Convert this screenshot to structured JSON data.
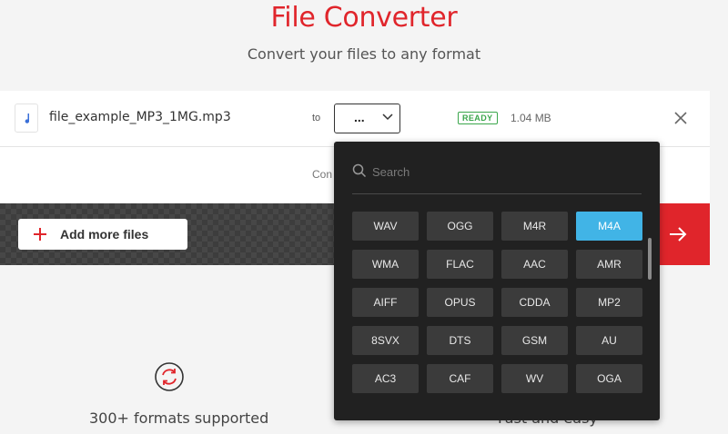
{
  "header": {
    "title": "File Converter",
    "subtitle": "Convert your files to any format"
  },
  "file": {
    "name": "file_example_MP3_1MG.mp3",
    "to_label": "to",
    "selected_format": "...",
    "status": "READY",
    "size": "1.04 MB"
  },
  "convert_hint": "Con",
  "actions": {
    "add_files_label": "Add more files"
  },
  "dropdown": {
    "search_placeholder": "Search",
    "formats": [
      "WAV",
      "OGG",
      "M4R",
      "M4A",
      "WMA",
      "FLAC",
      "AAC",
      "AMR",
      "AIFF",
      "OPUS",
      "CDDA",
      "MP2",
      "8SVX",
      "DTS",
      "GSM",
      "AU",
      "AC3",
      "CAF",
      "WV",
      "OGA"
    ],
    "active_format": "M4A"
  },
  "features": {
    "formats_supported": "300+ formats supported",
    "fast_easy": "Fast and easy"
  },
  "colors": {
    "brand_red": "#e0252b",
    "accent_blue": "#41b4e6",
    "ready_green": "#3aa64b",
    "dropdown_bg": "#212121"
  }
}
